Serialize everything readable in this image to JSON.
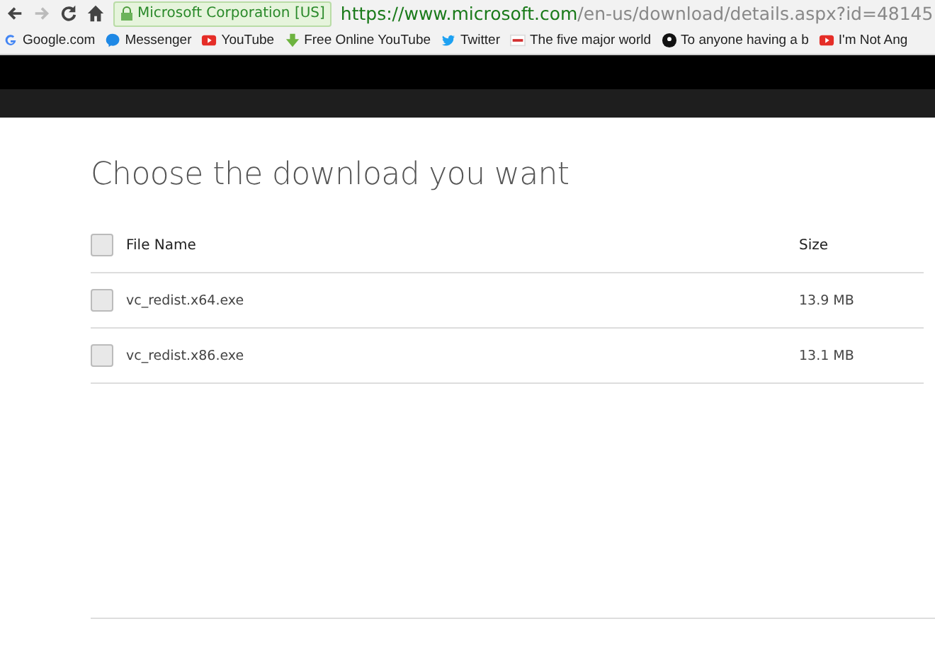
{
  "browser": {
    "identity": "Microsoft Corporation [US]",
    "url_host": "https://www.microsoft.com",
    "url_path": "/en-us/download/details.aspx?id=48145",
    "bookmarks": [
      {
        "kind": "google",
        "label": "Google.com"
      },
      {
        "kind": "messenger",
        "label": "Messenger"
      },
      {
        "kind": "youtube",
        "label": "YouTube"
      },
      {
        "kind": "download",
        "label": "Free Online YouTube"
      },
      {
        "kind": "twitter",
        "label": "Twitter"
      },
      {
        "kind": "news",
        "label": "The five major world"
      },
      {
        "kind": "nine",
        "label": "To anyone having a b"
      },
      {
        "kind": "youtube",
        "label": "I'm Not Ang"
      }
    ]
  },
  "page": {
    "title": "Choose the download you want",
    "columns": [
      "File Name",
      "Size"
    ],
    "select_all": {
      "checked": false
    },
    "rows": [
      {
        "name": "vc_redist.x64.exe",
        "size": "13.9 MB",
        "checked": false
      },
      {
        "name": "vc_redist.x86.exe",
        "size": "13.1 MB",
        "checked": false
      }
    ]
  }
}
